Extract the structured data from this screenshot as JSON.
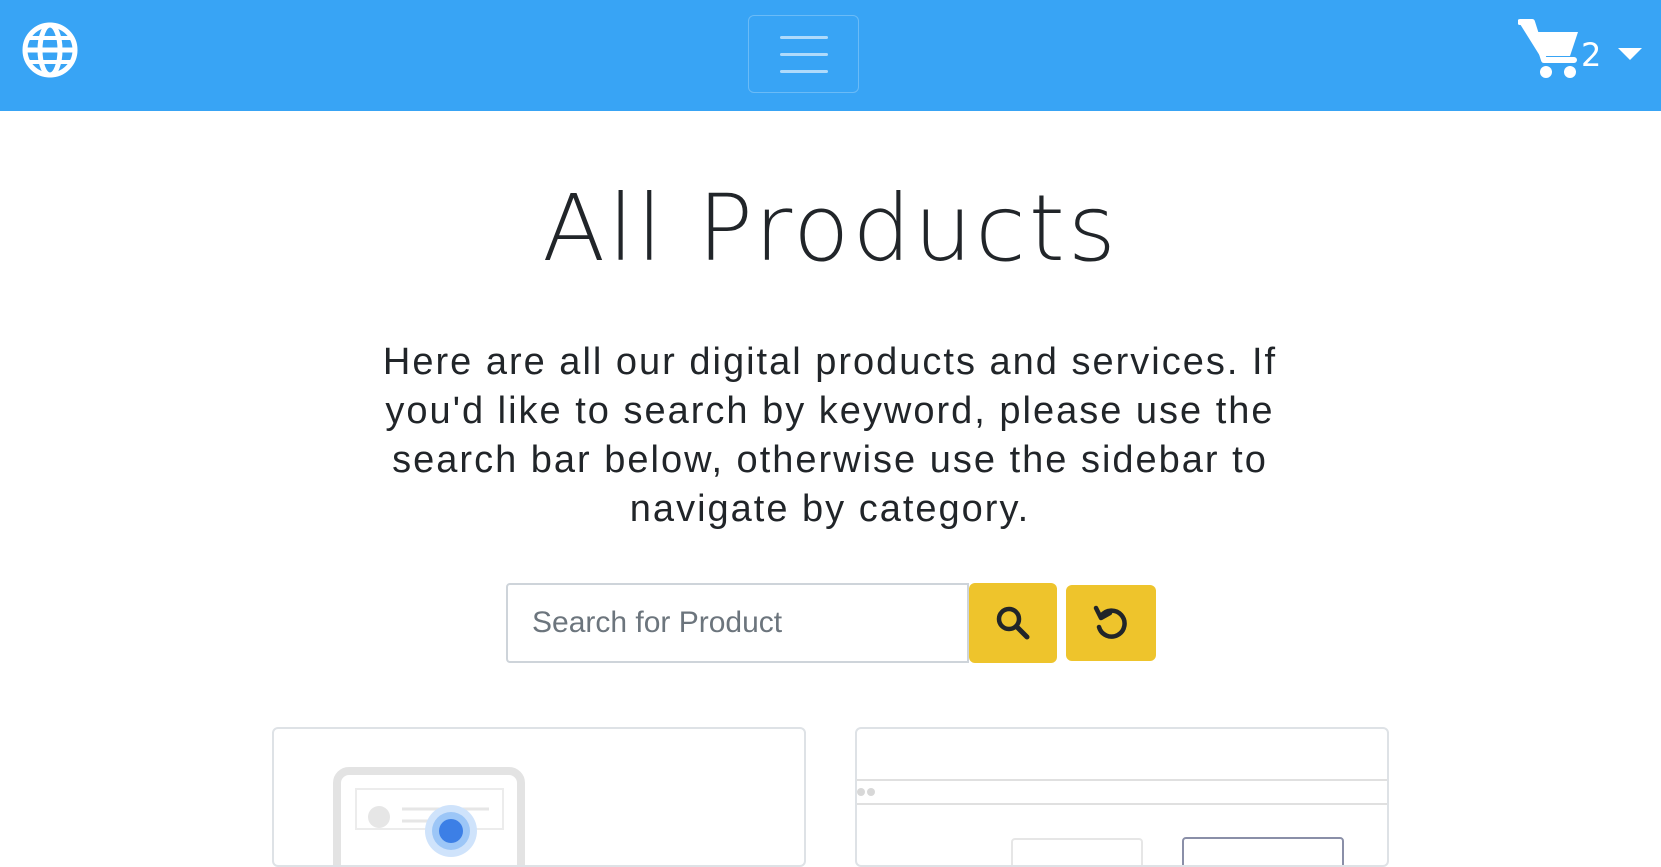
{
  "navbar": {
    "brand_icon": "globe-icon",
    "menu_icon": "hamburger-menu-icon",
    "cart_icon": "shopping-cart-icon",
    "cart_count": "2",
    "caret_icon": "caret-down-icon",
    "background_color": "#38a4f5"
  },
  "main": {
    "title": "All Products",
    "description": "Here are all our digital products and services. If you'd like to search by keyword, please use the search bar below, otherwise use the sidebar to navigate by category."
  },
  "search": {
    "placeholder": "Search for Product",
    "value": "",
    "search_icon": "search-icon",
    "reset_icon": "reset-icon",
    "button_color": "#eec42c"
  },
  "products": [
    {
      "thumbnail_icon": "product-thumbnail-1"
    },
    {
      "thumbnail_icon": "product-thumbnail-2"
    }
  ]
}
